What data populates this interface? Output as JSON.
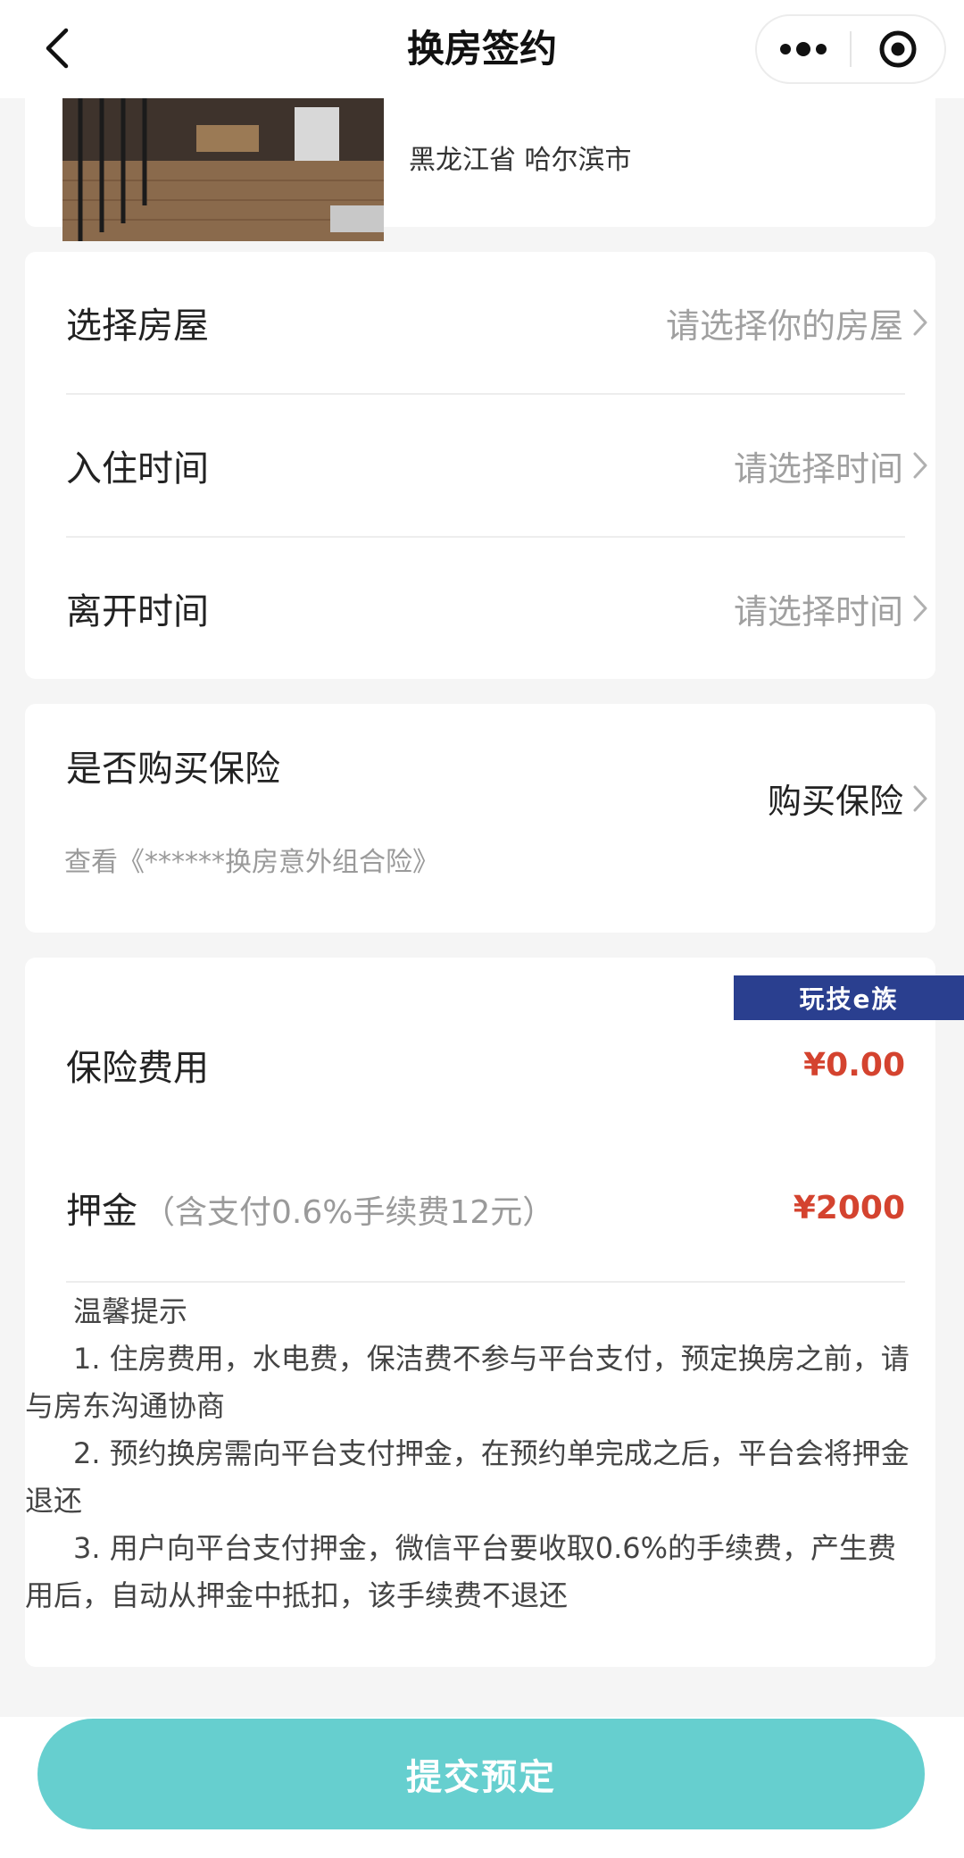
{
  "nav": {
    "title": "换房签约",
    "back_icon": "chevron-left-icon",
    "more_icon": "more-dots-icon",
    "target_icon": "target-icon"
  },
  "room": {
    "location": "黑龙江省 哈尔滨市"
  },
  "selection": {
    "house": {
      "label": "选择房屋",
      "placeholder": "请选择你的房屋"
    },
    "checkin": {
      "label": "入住时间",
      "placeholder": "请选择时间"
    },
    "checkout": {
      "label": "离开时间",
      "placeholder": "请选择时间"
    }
  },
  "insurance": {
    "label": "是否购买保险",
    "link": "查看《******换房意外组合险》",
    "action": "购买保险"
  },
  "fees": {
    "insurance_fee": {
      "label": "保险费用",
      "amount": "¥0.00"
    },
    "deposit": {
      "label": "押金",
      "note": "（含支付0.6%手续费12元）",
      "amount": "¥2000"
    }
  },
  "tips": {
    "title": "温馨提示",
    "items": [
      "1. 住房费用，水电费，保洁费不参与平台支付，预定换房之前，请与房东沟通协商",
      "2. 预约换房需向平台支付押金，在预约单完成之后，平台会将押金退还",
      "3. 用户向平台支付押金，微信平台要收取0.6%的手续费，产生费用后，自动从押金中抵扣，该手续费不退还"
    ]
  },
  "watermark": "玩技e族",
  "submit_label": "提交预定",
  "colors": {
    "price_red": "#d4432f",
    "submit_teal": "#66cfcf",
    "watermark_blue": "#2a3f8f"
  }
}
